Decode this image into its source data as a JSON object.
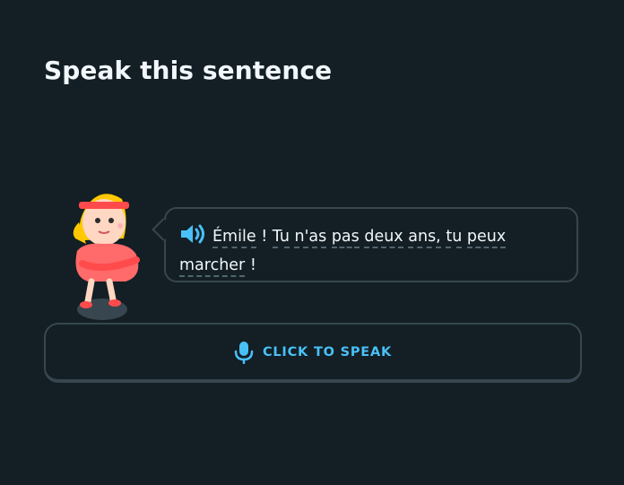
{
  "prompt": {
    "title": "Speak this sentence"
  },
  "character": {
    "icon": "character-illustration"
  },
  "speech_bubble": {
    "speaker_icon": "speaker-icon",
    "words": [
      "Émile",
      "!",
      "Tu",
      "n'as",
      "pas",
      "deux",
      "ans,",
      "tu",
      "peux",
      "marcher",
      "!"
    ]
  },
  "speak_button": {
    "label": "CLICK TO SPEAK",
    "icon": "microphone-icon"
  },
  "colors": {
    "background": "#131f24",
    "border": "#37464f",
    "accent": "#49c0f8",
    "text": "#f1f7fb"
  }
}
